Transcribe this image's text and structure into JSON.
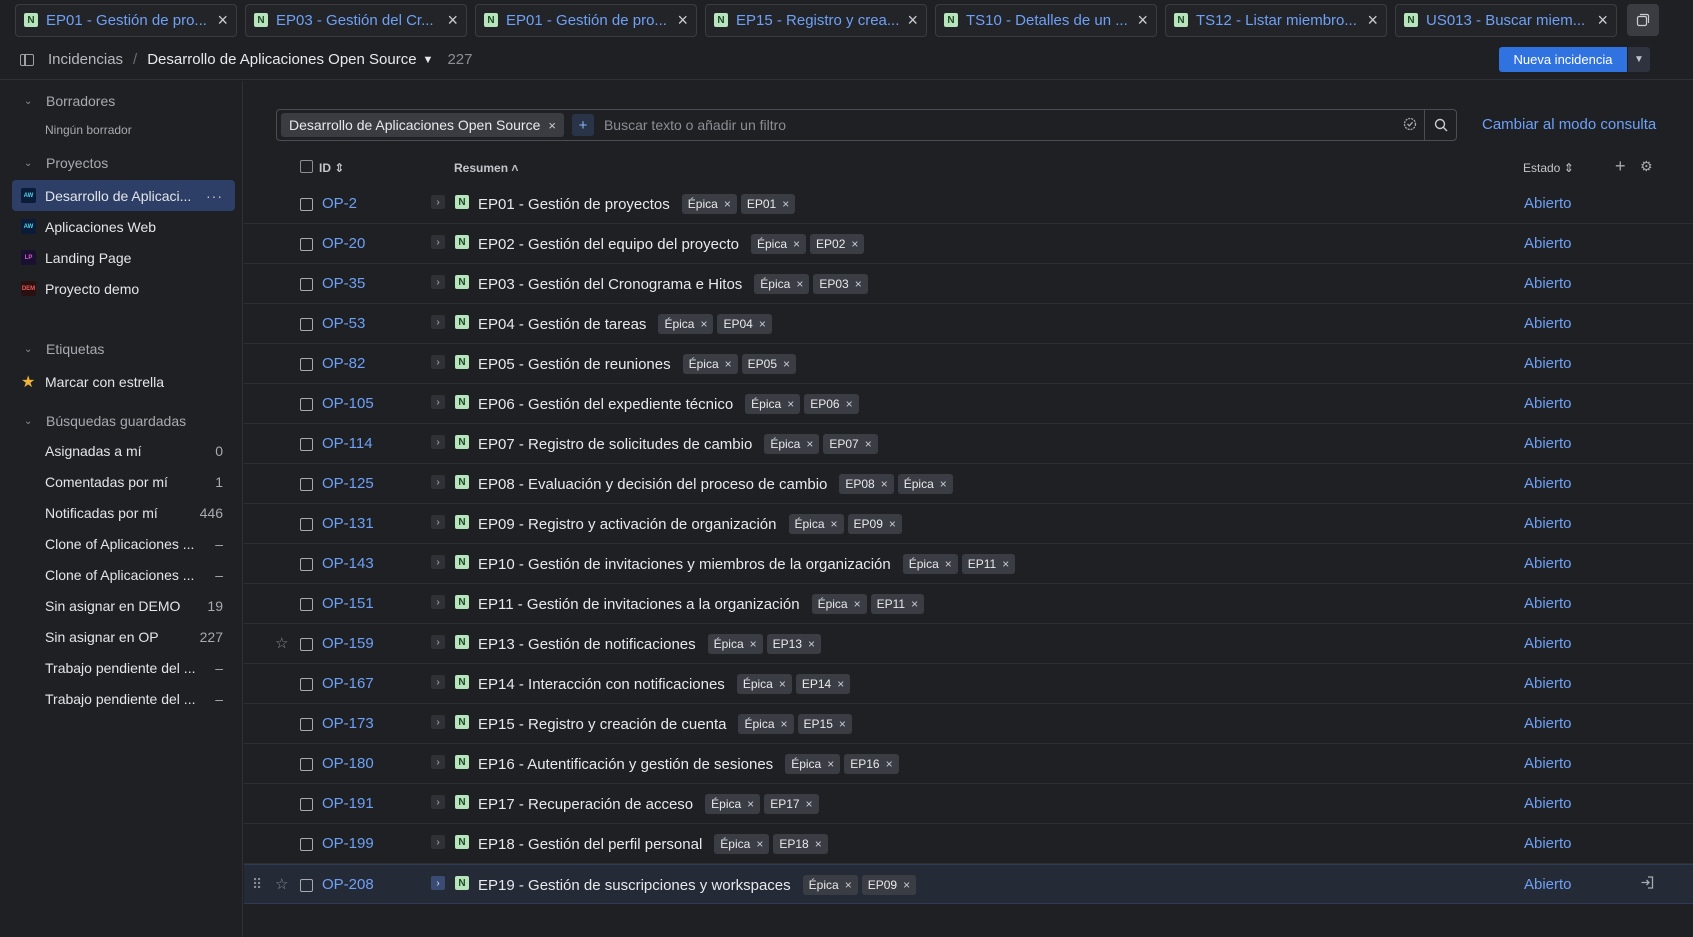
{
  "tabs": [
    {
      "label": "EP01 - Gestión de pro..."
    },
    {
      "label": "EP03 - Gestión del Cr..."
    },
    {
      "label": "EP01 - Gestión de pro..."
    },
    {
      "label": "EP15 - Registro y crea..."
    },
    {
      "label": "TS10 - Detalles de un ..."
    },
    {
      "label": "TS12 - Listar miembro..."
    },
    {
      "label": "US013 - Buscar miem..."
    }
  ],
  "breadcrumb": {
    "root": "Incidencias",
    "separator": "/",
    "current": "Desarrollo de Aplicaciones Open Source",
    "count": "227"
  },
  "header": {
    "new_issue_label": "Nueva incidencia"
  },
  "sidebar": {
    "drafts_heading": "Borradores",
    "drafts_empty": "Ningún borrador",
    "projects_heading": "Proyectos",
    "projects": [
      {
        "label": "Desarrollo de Aplicaci...",
        "icon_text": "AW",
        "icon_bg": "#0b1b3a",
        "icon_fg": "#4fd1e8"
      },
      {
        "label": "Aplicaciones Web",
        "icon_text": "AW",
        "icon_bg": "#0b1b3a",
        "icon_fg": "#4fd1e8"
      },
      {
        "label": "Landing Page",
        "icon_text": "LP",
        "icon_bg": "#1a1030",
        "icon_fg": "#e05bd7"
      },
      {
        "label": "Proyecto demo",
        "icon_text": "DEM",
        "icon_bg": "#2a1010",
        "icon_fg": "#f05a5a"
      }
    ],
    "labels_heading": "Etiquetas",
    "starred_label": "Marcar con estrella",
    "saved_heading": "Búsquedas guardadas",
    "saved": [
      {
        "label": "Asignadas a mí",
        "count": "0"
      },
      {
        "label": "Comentadas por mí",
        "count": "1"
      },
      {
        "label": "Notificadas por mí",
        "count": "446"
      },
      {
        "label": "Clone of Aplicaciones ...",
        "count": "–"
      },
      {
        "label": "Clone of Aplicaciones ...",
        "count": "–"
      },
      {
        "label": "Sin asignar en DEMO",
        "count": "19"
      },
      {
        "label": "Sin asignar en OP",
        "count": "227"
      },
      {
        "label": "Trabajo pendiente del ...",
        "count": "–"
      },
      {
        "label": "Trabajo pendiente del ...",
        "count": "–"
      }
    ]
  },
  "filter": {
    "chip": "Desarrollo de Aplicaciones Open Source",
    "placeholder": "Buscar texto o añadir un filtro",
    "mode_link": "Cambiar al modo consulta"
  },
  "table": {
    "col_id": "ID",
    "col_summary": "Resumen",
    "col_status": "Estado",
    "rows": [
      {
        "id": "OP-2",
        "summary": "EP01 - Gestión de proyectos",
        "tags": [
          "Épica",
          "EP01"
        ],
        "status": "Abierto"
      },
      {
        "id": "OP-20",
        "summary": "EP02 - Gestión del equipo del proyecto",
        "tags": [
          "Épica",
          "EP02"
        ],
        "status": "Abierto"
      },
      {
        "id": "OP-35",
        "summary": "EP03 - Gestión del Cronograma e Hitos",
        "tags": [
          "Épica",
          "EP03"
        ],
        "status": "Abierto"
      },
      {
        "id": "OP-53",
        "summary": "EP04 - Gestión de tareas",
        "tags": [
          "Épica",
          "EP04"
        ],
        "status": "Abierto"
      },
      {
        "id": "OP-82",
        "summary": "EP05 - Gestión de reuniones",
        "tags": [
          "Épica",
          "EP05"
        ],
        "status": "Abierto"
      },
      {
        "id": "OP-105",
        "summary": "EP06 - Gestión del expediente técnico",
        "tags": [
          "Épica",
          "EP06"
        ],
        "status": "Abierto"
      },
      {
        "id": "OP-114",
        "summary": "EP07 - Registro de solicitudes de cambio",
        "tags": [
          "Épica",
          "EP07"
        ],
        "status": "Abierto"
      },
      {
        "id": "OP-125",
        "summary": "EP08 - Evaluación y decisión del proceso de cambio",
        "tags": [
          "EP08",
          "Épica"
        ],
        "status": "Abierto"
      },
      {
        "id": "OP-131",
        "summary": "EP09 - Registro y activación de organización",
        "tags": [
          "Épica",
          "EP09"
        ],
        "status": "Abierto"
      },
      {
        "id": "OP-143",
        "summary": "EP10 - Gestión de invitaciones y miembros de la organización",
        "tags": [
          "Épica",
          "EP11"
        ],
        "status": "Abierto"
      },
      {
        "id": "OP-151",
        "summary": "EP11 - Gestión de invitaciones a la organización",
        "tags": [
          "Épica",
          "EP11"
        ],
        "status": "Abierto"
      },
      {
        "id": "OP-159",
        "summary": "EP13 - Gestión de notificaciones",
        "tags": [
          "Épica",
          "EP13"
        ],
        "status": "Abierto"
      },
      {
        "id": "OP-167",
        "summary": "EP14 - Interacción con notificaciones",
        "tags": [
          "Épica",
          "EP14"
        ],
        "status": "Abierto"
      },
      {
        "id": "OP-173",
        "summary": "EP15 - Registro y creación de cuenta",
        "tags": [
          "Épica",
          "EP15"
        ],
        "status": "Abierto"
      },
      {
        "id": "OP-180",
        "summary": "EP16 - Autentificación y gestión de sesiones",
        "tags": [
          "Épica",
          "EP16"
        ],
        "status": "Abierto"
      },
      {
        "id": "OP-191",
        "summary": "EP17 - Recuperación de acceso",
        "tags": [
          "Épica",
          "EP17"
        ],
        "status": "Abierto"
      },
      {
        "id": "OP-199",
        "summary": "EP18 - Gestión del perfil personal",
        "tags": [
          "Épica",
          "EP18"
        ],
        "status": "Abierto"
      },
      {
        "id": "OP-208",
        "summary": "EP19 - Gestión de suscripciones y workspaces",
        "tags": [
          "Épica",
          "EP09"
        ],
        "status": "Abierto"
      }
    ]
  },
  "icons": {
    "issue_type": "N",
    "tab_type": "N",
    "close": "×",
    "star": "★",
    "star_outline": "☆",
    "more": "···"
  },
  "colors": {
    "accent": "#2f72e0",
    "link": "#6ea0f6",
    "issue_type_bg": "#b7e4bd"
  }
}
